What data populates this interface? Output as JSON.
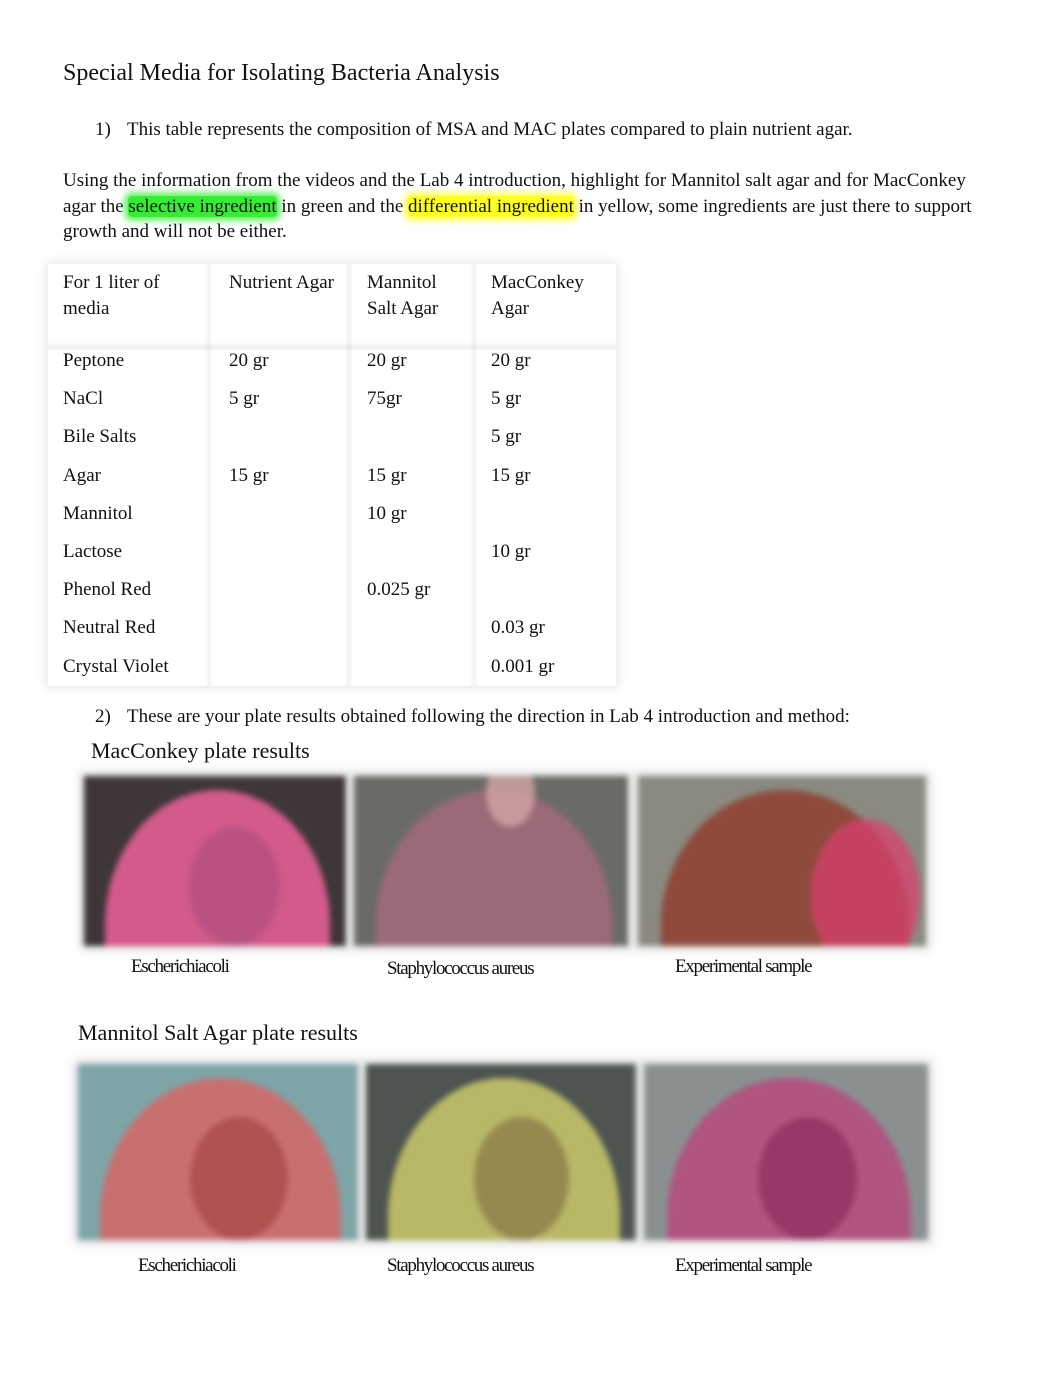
{
  "document": {
    "title": "Special Media for Isolating Bacteria Analysis",
    "question1": {
      "number": "1)",
      "text": "This table represents the composition of MSA and MAC plates compared to plain nutrient agar."
    },
    "instructions": {
      "part1": "Using the information from the videos and the Lab 4 introduction, highlight for Mannitol salt agar and for MacConkey agar the ",
      "selective_highlight": "selective ingredient",
      "part2": " in green and the ",
      "differential_highlight": "differential ingredient",
      "part3": " in yellow, some ingredients are just there to support growth and will not be either.",
      "highlight_colors": {
        "selective": "#33ee33",
        "differential": "#ffff22"
      }
    },
    "composition_table": {
      "headers": [
        "For 1 liter of media",
        "Nutrient Agar",
        "Mannitol Salt Agar",
        "MacConkey Agar"
      ],
      "header_lines": [
        [
          "For 1 liter of",
          "media"
        ],
        [
          "Nutrient Agar",
          ""
        ],
        [
          "Mannitol",
          "Salt Agar"
        ],
        [
          "MacConkey",
          "Agar"
        ]
      ],
      "rows": [
        [
          "Peptone",
          "20 gr",
          "20 gr",
          "20 gr"
        ],
        [
          "NaCl",
          "5 gr",
          "75gr",
          "5 gr"
        ],
        [
          "Bile Salts",
          "",
          "",
          "5 gr"
        ],
        [
          "Agar",
          "15 gr",
          "15 gr",
          "15 gr"
        ],
        [
          "Mannitol",
          "",
          "10 gr",
          ""
        ],
        [
          "Lactose",
          "",
          "",
          "10 gr"
        ],
        [
          "Phenol Red",
          "",
          "0.025 gr",
          ""
        ],
        [
          "Neutral Red",
          "",
          "",
          "0.03 gr"
        ],
        [
          "Crystal Violet",
          "",
          "",
          "0.001 gr"
        ]
      ]
    },
    "question2": {
      "number": "2)",
      "text": "These are your plate results obtained following the direction in Lab 4 introduction and method:"
    },
    "macconkey_results": {
      "heading": "MacConkey plate results",
      "plates": [
        {
          "caption": "Escherichiacoli",
          "colors": {
            "bg": "#3e3638",
            "agar": "#d35a8a",
            "accent": "#b05080"
          }
        },
        {
          "caption": "Staphylococcus aureus",
          "colors": {
            "bg": "#6b6b66",
            "agar": "#9a6a78",
            "accent": "#d8a8a8"
          }
        },
        {
          "caption": "Experimental sample",
          "colors": {
            "bg": "#8a8a80",
            "agar": "#8f4a3c",
            "accent": "#d8406e"
          }
        }
      ]
    },
    "msa_results": {
      "heading": "Mannitol Salt Agar plate results",
      "plates": [
        {
          "caption": "Escherichiacoli",
          "colors": {
            "bg": "#7ea5a8",
            "agar": "#c87070",
            "accent": "#a84848"
          }
        },
        {
          "caption": "Staphylococcus aureus",
          "colors": {
            "bg": "#4e5550",
            "agar": "#b8b866",
            "accent": "#8a7a4a"
          }
        },
        {
          "caption": "Experimental sample",
          "colors": {
            "bg": "#8a9090",
            "agar": "#b05580",
            "accent": "#8e3060"
          }
        }
      ]
    }
  }
}
